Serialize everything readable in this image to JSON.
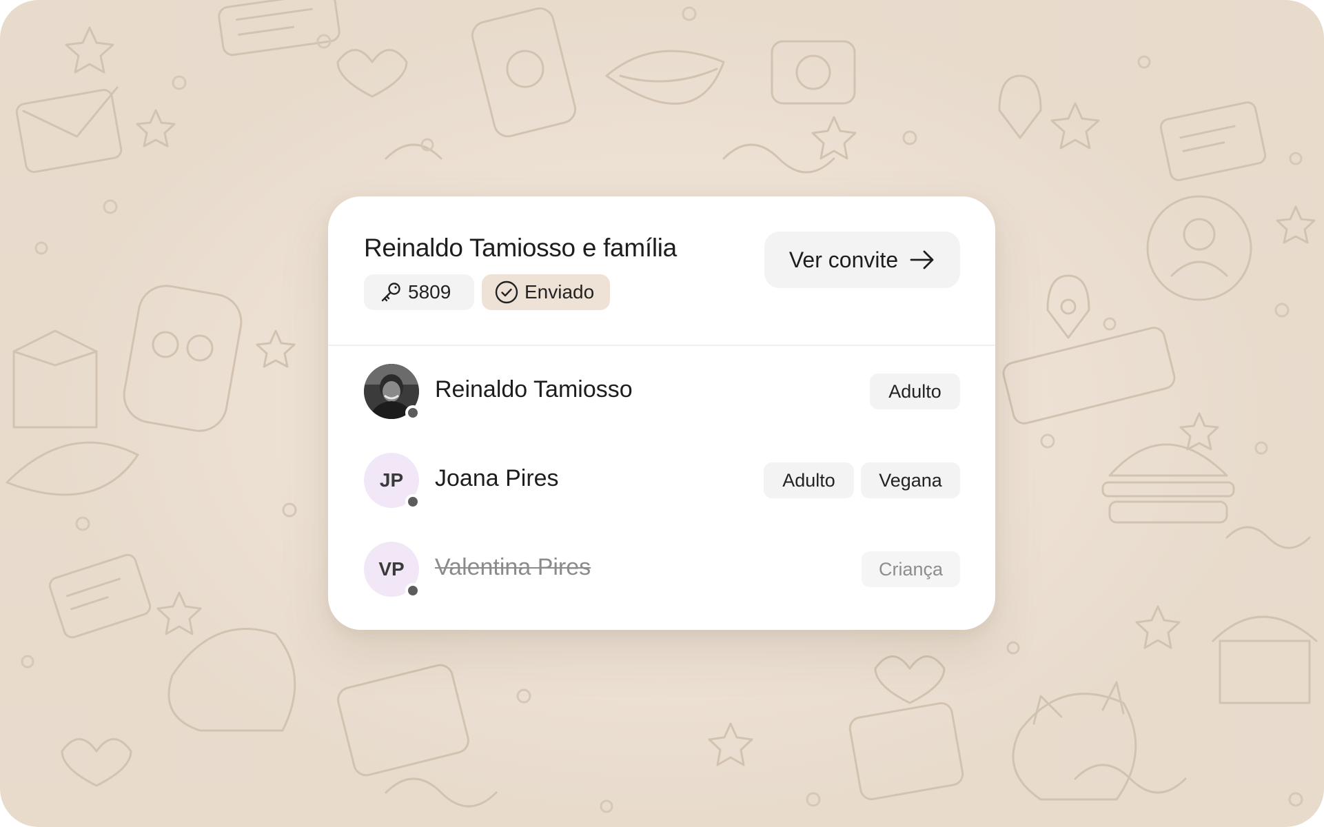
{
  "household": {
    "title": "Reinaldo Tamiosso e família",
    "code": "5809",
    "status_label": "Enviado",
    "view_invite_label": "Ver convite"
  },
  "icons": {
    "code": "key-icon",
    "status": "check-circle-icon",
    "view_invite": "arrow-right-icon"
  },
  "guests": [
    {
      "name": "Reinaldo Tamiosso",
      "avatar": "photo",
      "tags": [
        "Adulto"
      ],
      "removed": false
    },
    {
      "name": "Joana Pires",
      "initials": "JP",
      "tags": [
        "Adulto",
        "Vegana"
      ],
      "removed": false
    },
    {
      "name": "Valentina Pires",
      "initials": "VP",
      "tags": [
        "Criança"
      ],
      "removed": true
    }
  ],
  "colors": {
    "background": "#ede1d4",
    "status_chip": "#ede2d5",
    "neutral_chip": "#f3f3f4",
    "initials_avatar": "#f1e7f6",
    "presence_dot": "#5c5c5c"
  }
}
